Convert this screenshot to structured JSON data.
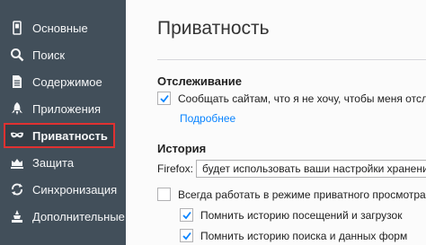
{
  "sidebar": {
    "items": [
      {
        "label": "Основные",
        "icon": "general-icon"
      },
      {
        "label": "Поиск",
        "icon": "search-icon"
      },
      {
        "label": "Содержимое",
        "icon": "content-icon"
      },
      {
        "label": "Приложения",
        "icon": "applications-icon"
      },
      {
        "label": "Приватность",
        "icon": "privacy-mask-icon",
        "selected": true
      },
      {
        "label": "Защита",
        "icon": "security-icon"
      },
      {
        "label": "Синхронизация",
        "icon": "sync-icon"
      },
      {
        "label": "Дополнительные",
        "icon": "advanced-icon"
      }
    ]
  },
  "main": {
    "title": "Приватность",
    "tracking": {
      "heading": "Отслеживание",
      "dnt_label": "Сообщать сайтам, что я не хочу, чтобы меня отслежи",
      "dnt_checked": true,
      "more_link": "Подробнее"
    },
    "history": {
      "heading": "История",
      "firefox_label": "Firefox:",
      "mode_value": "будет использовать ваши настройки хранения и",
      "private_mode_label": "Всегда работать в режиме приватного просмотра",
      "private_mode_checked": false,
      "remember_history_label": "Помнить историю посещений и загрузок",
      "remember_history_checked": true,
      "remember_search_label": "Помнить историю поиска и данных форм",
      "remember_search_checked": true
    }
  },
  "colors": {
    "sidebar_bg": "#424f5a",
    "accent": "#0a84ff",
    "highlight_border": "#e03131"
  }
}
